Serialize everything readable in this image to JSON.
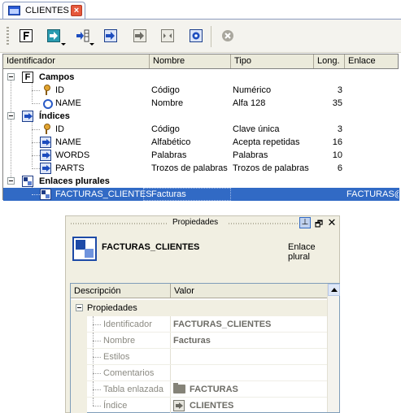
{
  "tab": {
    "title": "CLIENTES",
    "close_glyph": "×"
  },
  "toolbar": {
    "buttons": [
      {
        "name": "add-field-button",
        "icon": "field-F-icon"
      },
      {
        "name": "add-index-button",
        "icon": "index-icon",
        "dropdown": true
      },
      {
        "name": "add-link-button",
        "icon": "link-icon",
        "dropdown": true
      },
      {
        "name": "move-button",
        "icon": "arrow-icon"
      },
      {
        "name": "next-button",
        "icon": "arrow-gray-icon"
      },
      {
        "name": "resize-button",
        "icon": "resize-icon"
      },
      {
        "name": "settings-button",
        "icon": "gear-icon"
      },
      {
        "name": "delete-button",
        "icon": "cancel-icon"
      }
    ]
  },
  "grid": {
    "columns": [
      "Identificador",
      "Nombre",
      "Tipo",
      "Long.",
      "Enlace"
    ],
    "groups": {
      "campos": "Campos",
      "indices": "Índices",
      "enlaces": "Enlaces plurales"
    },
    "rows": {
      "campos": [
        {
          "id": "ID",
          "name": "Código",
          "type": "Numérico",
          "len": "3"
        },
        {
          "id": "NAME",
          "name": "Nombre",
          "type": "Alfa 128",
          "len": "35"
        }
      ],
      "indices": [
        {
          "id": "ID",
          "name": "Código",
          "type": "Clave única",
          "len": "3"
        },
        {
          "id": "NAME",
          "name": "Alfabético",
          "type": "Acepta repetidas",
          "len": "16"
        },
        {
          "id": "WORDS",
          "name": "Palabras",
          "type": "Palabras",
          "len": "10"
        },
        {
          "id": "PARTS",
          "name": "Trozos de palabras",
          "type": "Trozos de palabras",
          "len": "6"
        }
      ],
      "enlaces": [
        {
          "id": "FACTURAS_CLIENTES",
          "name": "Facturas",
          "type": "",
          "len": "",
          "link": "FACTURAS@I"
        }
      ]
    }
  },
  "props": {
    "title": "Propiedades",
    "pin_glyph": "⊥",
    "float_glyph": "🗗",
    "close_glyph": "✕",
    "object_name": "FACTURAS_CLIENTES",
    "object_type": "Enlace plural",
    "columns": [
      "Descripción",
      "Valor"
    ],
    "category": "Propiedades",
    "rows": [
      {
        "label": "Identificador",
        "value": "FACTURAS_CLIENTES"
      },
      {
        "label": "Nombre",
        "value": "Facturas"
      },
      {
        "label": "Estilos",
        "value": ""
      },
      {
        "label": "Comentarios",
        "value": ""
      },
      {
        "label": "Tabla enlazada",
        "value": "FACTURAS"
      },
      {
        "label": "Índice",
        "value": "CLIENTES"
      }
    ]
  },
  "colors": {
    "selection": "#316ac5",
    "header_bg": "#ebeadb",
    "panel_bg": "#f1efe2",
    "accent_blue": "#1d4aa7",
    "close_red": "#e5573c"
  }
}
